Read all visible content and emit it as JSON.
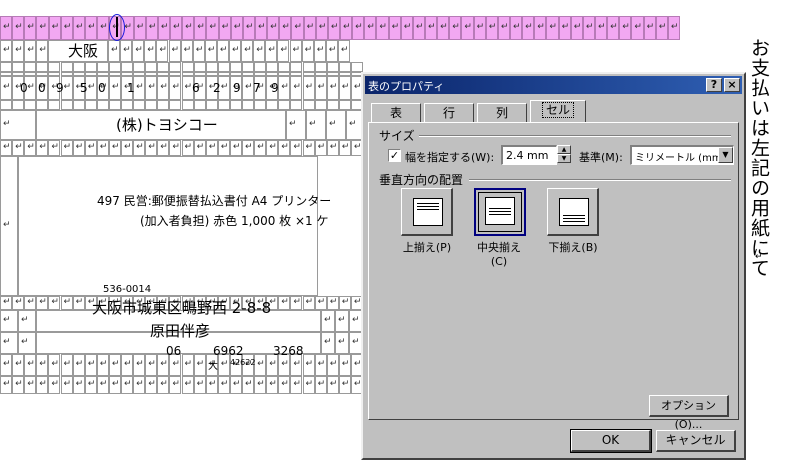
{
  "document": {
    "cell_mark": "↵",
    "cursor_mark": "↵",
    "row1": {
      "label": "大阪"
    },
    "row2": {
      "left_digits": [
        "0",
        "0",
        "9",
        "5",
        "0",
        "1"
      ],
      "right_digits": [
        "6",
        "2",
        "9",
        "7",
        "9"
      ]
    },
    "row3": {
      "company": "(株)トヨシコー"
    },
    "row4": {
      "line1": "497 民営:郵便振替払込書付 A4 プリンター",
      "line2": "(加入者負担) 赤色 1,000 枚 ×1 ケ"
    },
    "row5": {
      "postal_code": "536-0014",
      "address": "大阪市城東区鴫野西 2-8-8",
      "name": "原田伴彦",
      "phone_parts": [
        "06",
        "6962",
        "3268"
      ],
      "stamp_char": "大",
      "stamp_num": "42622"
    },
    "vertical_text": "お支払いは左記の用紙にて"
  },
  "dialog": {
    "title": "表のプロパティ",
    "help_button": "?",
    "close_button": "×",
    "tabs": [
      {
        "label": "表",
        "selected": false
      },
      {
        "label": "行",
        "selected": false
      },
      {
        "label": "列",
        "selected": false
      },
      {
        "label": "セル",
        "selected": true
      }
    ],
    "size_group": {
      "label": "サイズ",
      "specify_width_label": "幅を指定する(W):",
      "specify_width_checked": true,
      "width_value": "2.4 mm",
      "basis_label": "基準(M):",
      "basis_value": "ミリメートル (mm)"
    },
    "valign_group": {
      "label": "垂直方向の配置",
      "options": [
        {
          "label": "上揃え(P)",
          "selected": false
        },
        {
          "label": "中央揃え(C)",
          "selected": true
        },
        {
          "label": "下揃え(B)",
          "selected": false
        }
      ]
    },
    "options_button": "オプション(O)...",
    "ok_button": "OK",
    "cancel_button": "キャンセル"
  }
}
